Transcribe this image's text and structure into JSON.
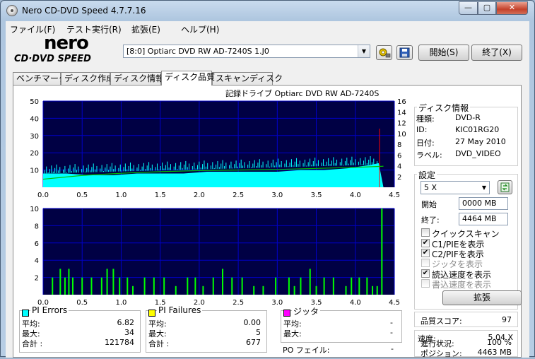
{
  "window": {
    "title": "Nero CD-DVD Speed 4.7.7.16",
    "minimize": "—",
    "maximize": "▢",
    "close": "✕"
  },
  "menu": [
    "ファイル(F)",
    "テスト実行(R)",
    "拡張(E)",
    "ヘルプ(H)"
  ],
  "logo": {
    "brand": "nero",
    "product": "CD·DVD SPEED"
  },
  "toolbar": {
    "drive": "[8:0]  Optiarc DVD RW AD-7240S 1.J0",
    "start_label": "開始(S)",
    "exit_label": "終了(X)"
  },
  "tabs": [
    "ベンチマーク",
    "ディスク作成",
    "ディスク情報",
    "ディスク品質",
    "スキャンディスク"
  ],
  "active_tab": "ディスク品質",
  "chart_header": "記録ドライブ Optiarc  DVD RW AD-7240S",
  "chart_data": [
    {
      "type": "area",
      "title": "記録ドライブ Optiarc  DVD RW AD-7240S",
      "x_range": [
        0.0,
        4.5
      ],
      "x_ticks": [
        "0.0",
        "0.5",
        "1.0",
        "1.5",
        "2.0",
        "2.5",
        "3.0",
        "3.5",
        "4.0",
        "4.5"
      ],
      "y_left_range": [
        0,
        50
      ],
      "y_left_ticks": [
        "10",
        "20",
        "30",
        "40",
        "50"
      ],
      "y_right_range": [
        0,
        16
      ],
      "y_right_ticks": [
        "2",
        "4",
        "6",
        "8",
        "10",
        "12",
        "14",
        "16"
      ],
      "grid": true,
      "series": [
        {
          "values_x": [
            0.0,
            0.3,
            0.6,
            0.9,
            1.2,
            1.5,
            1.8,
            2.1,
            2.4,
            2.7,
            3.0,
            3.3,
            3.6,
            3.9,
            4.2,
            4.3,
            4.36
          ],
          "values_y": [
            8,
            8,
            7,
            7,
            8,
            8,
            8,
            9,
            9,
            9,
            9,
            10,
            10,
            11,
            13,
            14,
            0
          ],
          "color": "#00ffff"
        },
        {
          "values_x": [
            0.0,
            0.5,
            1.0,
            1.5,
            2.0,
            2.5,
            3.0,
            3.5,
            4.0,
            4.36
          ],
          "values_y": [
            1.5,
            2.2,
            2.6,
            2.9,
            3.1,
            3.2,
            3.3,
            3.5,
            3.7,
            3.9
          ],
          "color": "#00c000"
        }
      ]
    },
    {
      "type": "bar",
      "x_range": [
        0.0,
        4.5
      ],
      "x_ticks": [
        "0.0",
        "0.5",
        "1.0",
        "1.5",
        "2.0",
        "2.5",
        "3.0",
        "3.5",
        "4.0",
        "4.5"
      ],
      "y_range": [
        0,
        10
      ],
      "y_ticks": [
        "2",
        "4",
        "6",
        "8",
        "10"
      ],
      "grid": true,
      "series": [
        {
          "color": "#00ff00",
          "x": [
            0.12,
            0.22,
            0.28,
            0.33,
            0.38,
            0.5,
            0.62,
            0.75,
            0.82,
            0.9,
            0.98,
            1.08,
            1.15,
            1.3,
            1.42,
            1.55,
            1.7,
            1.85,
            1.95,
            2.05,
            2.18,
            2.3,
            2.42,
            2.55,
            2.7,
            2.82,
            2.98,
            3.15,
            3.22,
            3.3,
            3.42,
            3.5,
            3.6,
            3.72,
            3.88,
            3.95,
            4.05,
            4.15,
            4.22,
            4.28,
            4.34
          ],
          "y": [
            2,
            3,
            2,
            3,
            2,
            2,
            2,
            2,
            3,
            3,
            2,
            2,
            1,
            2,
            2,
            2,
            1,
            2,
            2,
            1,
            2,
            3,
            2,
            2,
            1,
            1,
            2,
            2,
            1,
            2,
            3,
            1,
            2,
            2,
            1,
            2,
            2,
            2,
            1,
            1,
            10
          ]
        }
      ]
    }
  ],
  "pi_errors": {
    "title": "PI Errors",
    "color": "#00ffff",
    "avg_label": "平均:",
    "avg": "6.82",
    "max_label": "最大:",
    "max": "34",
    "total_label": "合計 :",
    "total": "121784"
  },
  "pi_failures": {
    "title": "PI Failures",
    "color": "#ffff00",
    "avg_label": "平均:",
    "avg": "0.00",
    "max_label": "最大:",
    "max": "5",
    "total_label": "合計 :",
    "total": "677"
  },
  "jitter": {
    "title": "ジッタ",
    "color": "#ff00ff",
    "avg_label": "平均:",
    "avg": "-",
    "max_label": "最大:",
    "max": "-"
  },
  "po_failures": {
    "label": "PO フェイル:",
    "value": "-"
  },
  "disc_info": {
    "title": "ディスク情報",
    "type_label": "種類:",
    "type": "DVD-R",
    "id_label": "ID:",
    "id": "KIC01RG20",
    "date_label": "日付:",
    "date": "27 May 2010",
    "label_label": "ラベル:",
    "label": "DVD_VIDEO"
  },
  "settings": {
    "title": "設定",
    "speed": "5 X",
    "start_label": "開始",
    "start": "0000 MB",
    "end_label": "終了:",
    "end": "4464 MB",
    "quick_scan": "クイックスキャン",
    "show_c1pie": "C1/PIEを表示",
    "show_c2pif": "C2/PIFを表示",
    "show_jitter": "ジッタを表示",
    "show_read": "読込速度を表示",
    "show_write": "書込速度を表示",
    "advanced_label": "拡張"
  },
  "quality": {
    "label": "品質スコア:",
    "value": "97"
  },
  "progress": {
    "progress_label": "進行状況:",
    "progress": "100 %",
    "position_label": "ポジション:",
    "position": "4463 MB",
    "speed_label": "速度:",
    "speed": "5.04 X"
  }
}
